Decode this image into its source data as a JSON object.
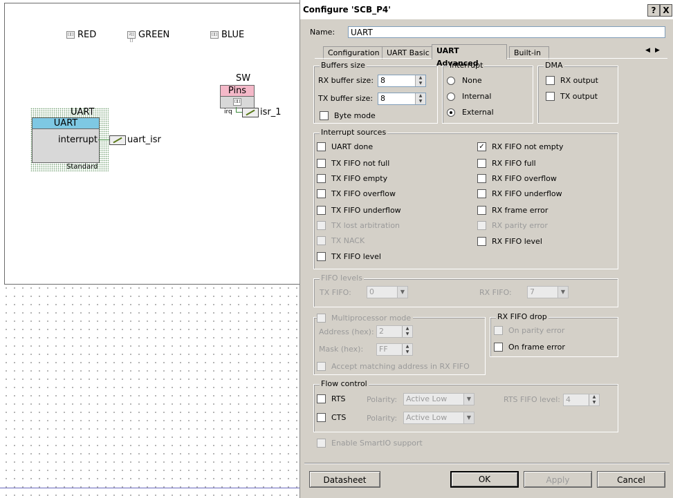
{
  "canvas": {
    "pins": [
      {
        "icon": "pin-icon",
        "icon_text": "[][]",
        "label": "RED"
      },
      {
        "icon": "pin-icon",
        "icon_text": "2[][]",
        "label": "GREEN"
      },
      {
        "icon": "pin-icon",
        "icon_text": "[][]",
        "label": "BLUE"
      }
    ],
    "uart_component": {
      "title": "UART",
      "header": "UART",
      "terminal": "interrupt",
      "subtitle": "Standard",
      "isr": "uart_isr"
    },
    "sw_component": {
      "title": "SW",
      "header": "Pins",
      "sub_icon": "[][]",
      "terminal": "irq",
      "isr": "isr_1"
    }
  },
  "dialog": {
    "title": "Configure 'SCB_P4'",
    "help_btn": "?",
    "close_btn": "X",
    "name_label": "Name:",
    "name_value": "UART",
    "tabs": [
      "Configuration",
      "UART Basic",
      "UART Advanced",
      "Built-in"
    ],
    "active_tab": "UART Advanced",
    "buffers": {
      "title": "Buffers size",
      "rx_label": "RX buffer size:",
      "rx_value": "8",
      "tx_label": "TX buffer size:",
      "tx_value": "8",
      "byte_mode": "Byte mode"
    },
    "interrupt": {
      "title": "Interrupt",
      "options": [
        "None",
        "Internal",
        "External"
      ],
      "selected": "External"
    },
    "dma": {
      "title": "DMA",
      "rx": "RX output",
      "tx": "TX output"
    },
    "interrupt_sources": {
      "title": "Interrupt sources",
      "left": [
        {
          "label": "UART done",
          "checked": false,
          "enabled": true
        },
        {
          "label": "TX FIFO not full",
          "checked": false,
          "enabled": true
        },
        {
          "label": "TX FIFO empty",
          "checked": false,
          "enabled": true
        },
        {
          "label": "TX FIFO overflow",
          "checked": false,
          "enabled": true
        },
        {
          "label": "TX FIFO underflow",
          "checked": false,
          "enabled": true
        },
        {
          "label": "TX lost arbitration",
          "checked": false,
          "enabled": false
        },
        {
          "label": "TX NACK",
          "checked": false,
          "enabled": false
        },
        {
          "label": "TX FIFO level",
          "checked": false,
          "enabled": true
        }
      ],
      "right": [
        {
          "label": "RX FIFO not empty",
          "checked": true,
          "enabled": true
        },
        {
          "label": "RX FIFO full",
          "checked": false,
          "enabled": true
        },
        {
          "label": "RX FIFO overflow",
          "checked": false,
          "enabled": true
        },
        {
          "label": "RX FIFO underflow",
          "checked": false,
          "enabled": true
        },
        {
          "label": "RX frame error",
          "checked": false,
          "enabled": true
        },
        {
          "label": "RX parity error",
          "checked": false,
          "enabled": false
        },
        {
          "label": "RX FIFO level",
          "checked": false,
          "enabled": true
        }
      ]
    },
    "fifo_levels": {
      "title": "FIFO levels",
      "tx_label": "TX FIFO:",
      "tx_value": "0",
      "rx_label": "RX FIFO:",
      "rx_value": "7"
    },
    "multiprocessor": {
      "title": "Multiprocessor mode",
      "address_label": "Address (hex):",
      "address_value": "2",
      "mask_label": "Mask (hex):",
      "mask_value": "FF",
      "accept": "Accept matching address in RX FIFO"
    },
    "rx_fifo_drop": {
      "title": "RX FIFO drop",
      "parity": "On parity error",
      "frame": "On frame error"
    },
    "flow_control": {
      "title": "Flow control",
      "rts": "RTS",
      "cts": "CTS",
      "polarity_label": "Polarity:",
      "polarity_value": "Active Low",
      "rts_level_label": "RTS FIFO level:",
      "rts_level_value": "4"
    },
    "smartio": "Enable SmartIO support",
    "buttons": {
      "datasheet": "Datasheet",
      "ok": "OK",
      "apply": "Apply",
      "cancel": "Cancel"
    },
    "tab_nav": {
      "left": "◀",
      "right": "▶"
    }
  }
}
